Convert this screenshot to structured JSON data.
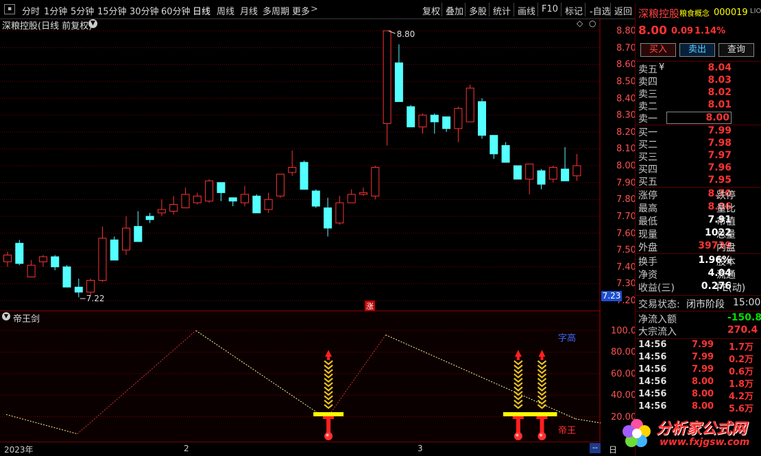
{
  "colors": {
    "up": "#ff3333",
    "down": "#54ffff",
    "grid": "#7a0000",
    "axis": "#a00000",
    "label_red": "#ff5050",
    "line_white": "#ffff99",
    "yellow": "#ffff00"
  },
  "toolbar": {
    "periods": [
      "分时",
      "1分钟",
      "5分钟",
      "15分钟",
      "30分钟",
      "60分钟",
      "日线",
      "周线",
      "月线",
      "多周期",
      "更多"
    ],
    "active_period": "日线",
    "right_buttons": [
      "复权",
      "叠加",
      "多股",
      "统计",
      "画线",
      "F10",
      "标记",
      "-自选",
      "返回"
    ]
  },
  "main_chart": {
    "title": "深粮控股(日线 前复权)",
    "high_label": "8.80",
    "low_label": "7.22",
    "current_price_tag": "7.23",
    "zhang_marker": "涨",
    "yticks": [
      "8.80",
      "8.70",
      "8.60",
      "8.50",
      "8.40",
      "8.30",
      "8.20",
      "8.10",
      "8.00",
      "7.90",
      "7.80",
      "7.70",
      "7.60",
      "7.50",
      "7.40",
      "7.30",
      "7.20"
    ]
  },
  "chart_data": [
    {
      "type": "candlestick",
      "candles": [
        {
          "o": 7.43,
          "h": 7.49,
          "l": 7.4,
          "c": 7.47
        },
        {
          "o": 7.54,
          "h": 7.56,
          "l": 7.41,
          "c": 7.42
        },
        {
          "o": 7.34,
          "h": 7.44,
          "l": 7.34,
          "c": 7.41
        },
        {
          "o": 7.43,
          "h": 7.47,
          "l": 7.4,
          "c": 7.46
        },
        {
          "o": 7.46,
          "h": 7.47,
          "l": 7.38,
          "c": 7.4
        },
        {
          "o": 7.4,
          "h": 7.41,
          "l": 7.28,
          "c": 7.28
        },
        {
          "o": 7.28,
          "h": 7.33,
          "l": 7.22,
          "c": 7.25
        },
        {
          "o": 7.25,
          "h": 7.33,
          "l": 7.23,
          "c": 7.32
        },
        {
          "o": 7.32,
          "h": 7.64,
          "l": 7.31,
          "c": 7.57
        },
        {
          "o": 7.56,
          "h": 7.58,
          "l": 7.44,
          "c": 7.44
        },
        {
          "o": 7.5,
          "h": 7.7,
          "l": 7.47,
          "c": 7.63
        },
        {
          "o": 7.64,
          "h": 7.73,
          "l": 7.55,
          "c": 7.55
        },
        {
          "o": 7.7,
          "h": 7.72,
          "l": 7.66,
          "c": 7.68
        },
        {
          "o": 7.72,
          "h": 7.8,
          "l": 7.7,
          "c": 7.74
        },
        {
          "o": 7.73,
          "h": 7.82,
          "l": 7.71,
          "c": 7.77
        },
        {
          "o": 7.75,
          "h": 7.87,
          "l": 7.75,
          "c": 7.83
        },
        {
          "o": 7.78,
          "h": 7.84,
          "l": 7.77,
          "c": 7.82
        },
        {
          "o": 7.79,
          "h": 7.92,
          "l": 7.78,
          "c": 7.91
        },
        {
          "o": 7.9,
          "h": 7.9,
          "l": 7.79,
          "c": 7.84
        },
        {
          "o": 7.81,
          "h": 7.81,
          "l": 7.76,
          "c": 7.79
        },
        {
          "o": 7.78,
          "h": 7.88,
          "l": 7.76,
          "c": 7.83
        },
        {
          "o": 7.82,
          "h": 7.83,
          "l": 7.72,
          "c": 7.72
        },
        {
          "o": 7.74,
          "h": 7.84,
          "l": 7.72,
          "c": 7.8
        },
        {
          "o": 7.82,
          "h": 7.95,
          "l": 7.81,
          "c": 7.95
        },
        {
          "o": 7.96,
          "h": 8.09,
          "l": 7.94,
          "c": 7.99
        },
        {
          "o": 8.02,
          "h": 8.03,
          "l": 7.86,
          "c": 7.86
        },
        {
          "o": 7.85,
          "h": 7.86,
          "l": 7.75,
          "c": 7.76
        },
        {
          "o": 7.75,
          "h": 7.81,
          "l": 7.58,
          "c": 7.63
        },
        {
          "o": 7.66,
          "h": 7.82,
          "l": 7.65,
          "c": 7.78
        },
        {
          "o": 7.78,
          "h": 7.86,
          "l": 7.78,
          "c": 7.83
        },
        {
          "o": 7.83,
          "h": 7.87,
          "l": 7.82,
          "c": 7.84
        },
        {
          "o": 7.82,
          "h": 8.0,
          "l": 7.8,
          "c": 7.99
        },
        {
          "o": 8.25,
          "h": 8.8,
          "l": 8.12,
          "c": 8.8
        },
        {
          "o": 8.61,
          "h": 8.72,
          "l": 8.38,
          "c": 8.38
        },
        {
          "o": 8.35,
          "h": 8.36,
          "l": 8.23,
          "c": 8.23
        },
        {
          "o": 8.23,
          "h": 8.31,
          "l": 8.19,
          "c": 8.3
        },
        {
          "o": 8.3,
          "h": 8.31,
          "l": 8.19,
          "c": 8.26
        },
        {
          "o": 8.29,
          "h": 8.29,
          "l": 8.2,
          "c": 8.22
        },
        {
          "o": 8.22,
          "h": 8.35,
          "l": 8.14,
          "c": 8.34
        },
        {
          "o": 8.26,
          "h": 8.48,
          "l": 8.26,
          "c": 8.46
        },
        {
          "o": 8.38,
          "h": 8.4,
          "l": 8.16,
          "c": 8.18
        },
        {
          "o": 8.18,
          "h": 8.18,
          "l": 8.04,
          "c": 8.07
        },
        {
          "o": 8.12,
          "h": 8.14,
          "l": 8.02,
          "c": 8.02
        },
        {
          "o": 8.0,
          "h": 8.0,
          "l": 7.92,
          "c": 7.92
        },
        {
          "o": 7.92,
          "h": 8.01,
          "l": 7.83,
          "c": 8.01
        },
        {
          "o": 7.97,
          "h": 7.98,
          "l": 7.86,
          "c": 7.89
        },
        {
          "o": 7.92,
          "h": 8.0,
          "l": 7.9,
          "c": 7.99
        },
        {
          "o": 7.98,
          "h": 8.11,
          "l": 7.93,
          "c": 7.91
        },
        {
          "o": 7.94,
          "h": 8.07,
          "l": 7.91,
          "c": 8.0
        }
      ],
      "ylim": [
        7.2,
        8.85
      ]
    },
    {
      "type": "line",
      "title": "帝王剑",
      "yticks": [
        "100.0",
        "80.00",
        "60.00",
        "40.00",
        "20.00"
      ],
      "ylim": [
        0,
        105
      ],
      "x": [
        0,
        6,
        16,
        27,
        32,
        48,
        58,
        62
      ],
      "y": [
        22,
        4,
        100,
        18,
        96,
        18,
        0,
        0
      ]
    }
  ],
  "indicator": {
    "title": "帝王剑",
    "label_blue": "字高",
    "label_red": "帝王"
  },
  "xaxis": {
    "labels": [
      "2023年",
      "2",
      "3"
    ],
    "unit_btn": "日"
  },
  "quote": {
    "name": "深粮控股",
    "concept": "粮食概念",
    "code": "000019",
    "tag": "LIO",
    "price": "8.00",
    "change": "0.09",
    "pct": "1.14%",
    "buttons": [
      "买入",
      "卖出",
      "查询"
    ],
    "asks": [
      {
        "l": "卖五",
        "yen": "¥",
        "v": "8.04"
      },
      {
        "l": "卖四",
        "v": "8.03"
      },
      {
        "l": "卖三",
        "v": "8.02"
      },
      {
        "l": "卖二",
        "v": "8.01"
      },
      {
        "l": "卖一",
        "v": "8.00"
      }
    ],
    "bids": [
      {
        "l": "买一",
        "v": "7.99"
      },
      {
        "l": "买二",
        "v": "7.98"
      },
      {
        "l": "买三",
        "v": "7.97"
      },
      {
        "l": "买四",
        "v": "7.96"
      },
      {
        "l": "买五",
        "v": "7.95"
      }
    ],
    "stats1": [
      {
        "l": "涨停",
        "v": "8.70",
        "r": "跌停",
        "c": "red"
      },
      {
        "l": "最高",
        "v": "8.06",
        "r": "量比",
        "c": "red"
      },
      {
        "l": "最低",
        "v": "7.91",
        "r": "市值",
        "c": "wht"
      },
      {
        "l": "现量",
        "v": "1022",
        "r": "总量",
        "c": "wht"
      },
      {
        "l": "外盘",
        "v": "39739",
        "r": "内盘",
        "c": "red"
      }
    ],
    "stats2": [
      {
        "l": "换手",
        "v": "1.96%",
        "r": "股本",
        "c": "wht"
      },
      {
        "l": "净资",
        "v": "4.04",
        "r": "流通",
        "c": "wht"
      },
      {
        "l": "收益(三)",
        "v": "0.276",
        "r": "PE(动)",
        "c": "wht"
      }
    ],
    "status_label": "交易状态:",
    "status_value": "闭市阶段",
    "status_time": "15:00",
    "flow": [
      {
        "l": "净流入额",
        "v": "-150.8",
        "c": "grn"
      },
      {
        "l": "大宗流入",
        "v": "270.4",
        "c": "red"
      }
    ],
    "ticks": [
      {
        "t": "14:56",
        "p": "7.99",
        "q": "1.7万"
      },
      {
        "t": "14:56",
        "p": "7.99",
        "q": "0.2万"
      },
      {
        "t": "14:56",
        "p": "7.99",
        "q": "0.6万"
      },
      {
        "t": "14:56",
        "p": "8.00",
        "q": "1.8万"
      },
      {
        "t": "14:56",
        "p": "8.00",
        "q": "4.2万"
      },
      {
        "t": "14:56",
        "p": "8.00",
        "q": "5.6万"
      }
    ]
  },
  "watermark": {
    "text": "分析家公式网",
    "url": "www.fxjgsw.com"
  }
}
